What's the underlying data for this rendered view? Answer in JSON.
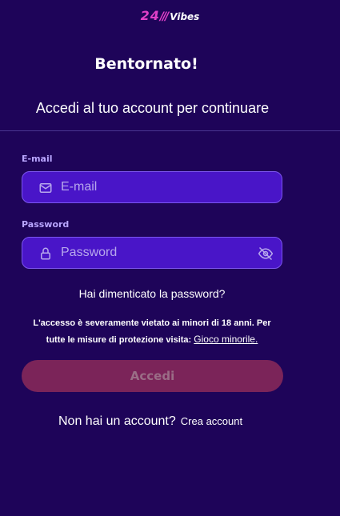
{
  "brand": {
    "logo_number": "24",
    "logo_slashes": "///",
    "logo_word": "Vibes",
    "accent_color": "#e040c8"
  },
  "page": {
    "title": "Bentornato!",
    "subtitle": "Accedi al tuo account per continuare",
    "background_color": "#1e0459"
  },
  "form": {
    "email": {
      "label": "E-mail",
      "placeholder": "E-mail",
      "value": "",
      "icon": "envelope-icon"
    },
    "password": {
      "label": "Password",
      "placeholder": "Password",
      "value": "",
      "icon": "lock-icon",
      "toggle_icon": "eye-off-icon"
    },
    "forgot_password": "Hai dimenticato la password?",
    "notice_text": "L'accesso è severamente vietato ai minori di 18 anni. Per tutte le misure di protezione visita:",
    "notice_link": "Gioco minorile.",
    "submit_label": "Accedi",
    "submit_color": "#7b2459"
  },
  "signup": {
    "prompt": "Non hai un account?",
    "link": "Crea account"
  }
}
